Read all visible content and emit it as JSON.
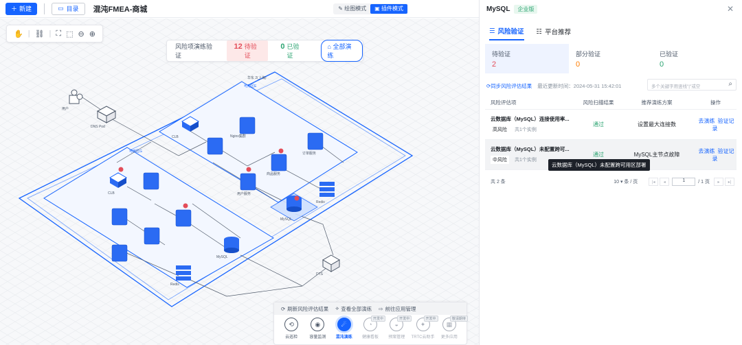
{
  "header": {
    "new_label": "新建",
    "dir_label": "目录",
    "title": "混沌FMEA-商城",
    "mode_draw": "绘图模式",
    "mode_plugin": "插件模式"
  },
  "summary": {
    "label": "风险项演练验证",
    "pending_num": "12",
    "pending_label": "待验证",
    "verified_num": "0",
    "verified_label": "已验证",
    "run_all": "全部演练"
  },
  "diagram": {
    "region_outer_label": "华东 2(上海)",
    "az1_label": "可用区G",
    "az2_label": "可用区E",
    "user": "用户",
    "dns": "DNS Pod",
    "clb1": "CLB",
    "clb2": "CLB",
    "nginx": "Nginx集群",
    "order_svc": "订单服务",
    "user_svc": "用户服务",
    "product_svc": "商品服务",
    "mysql": "MySQL",
    "redis": "Redis",
    "dts": "DTS"
  },
  "bottom_panel": {
    "links": [
      "刷新风险评估结果",
      "查看全部演练",
      "前往应用管理"
    ],
    "items": [
      {
        "label": "云巡检",
        "badge": ""
      },
      {
        "label": "容量监测",
        "badge": ""
      },
      {
        "label": "混沌演练",
        "badge": ""
      },
      {
        "label": "健康看板",
        "badge": "开发中"
      },
      {
        "label": "预案管理",
        "badge": "开发中"
      },
      {
        "label": "TRTC云助手",
        "badge": "开发中"
      },
      {
        "label": "更多应用",
        "badge": "敬请期待"
      }
    ]
  },
  "panel": {
    "title": "MySQL",
    "edition": "企业版",
    "tab_risk": "风险验证",
    "tab_platform": "平台推荐",
    "stats": [
      {
        "label": "待验证",
        "value": "2"
      },
      {
        "label": "部分验证",
        "value": "0"
      },
      {
        "label": "已验证",
        "value": "0"
      }
    ],
    "sync_link": "同步风险评估结果",
    "last_update": "最近更新时间：2024-05-31 15:42:01",
    "search_placeholder": "多个关键字用竖线\"|\"或空",
    "columns": [
      "风险评估项",
      "风险扫描结果",
      "推荐演练方案",
      "操作"
    ],
    "rows": [
      {
        "title": "云数据库（MySQL）连接使用率...",
        "level": "高风险",
        "instances": "共1个实例",
        "scan": "通过",
        "plan": "设置最大连接数",
        "op1": "去演练",
        "op2": "验证记录"
      },
      {
        "title": "云数据库（MySQL）未配置跨可...",
        "level": "中风险",
        "instances": "共1个实例",
        "scan": "通过",
        "plan": "MySQL主节点故障",
        "op1": "去演练",
        "op2": "验证记录"
      }
    ],
    "tooltip": "云数据库（MySQL）未配置跨可用区部署",
    "pager": {
      "total": "共 2 条",
      "size": "10 ▾ 条 / 页",
      "page": "1",
      "pages": "/ 1 页"
    }
  },
  "colors": {
    "accent": "#1664ff",
    "success": "#2ba471",
    "danger": "#e34d59"
  }
}
